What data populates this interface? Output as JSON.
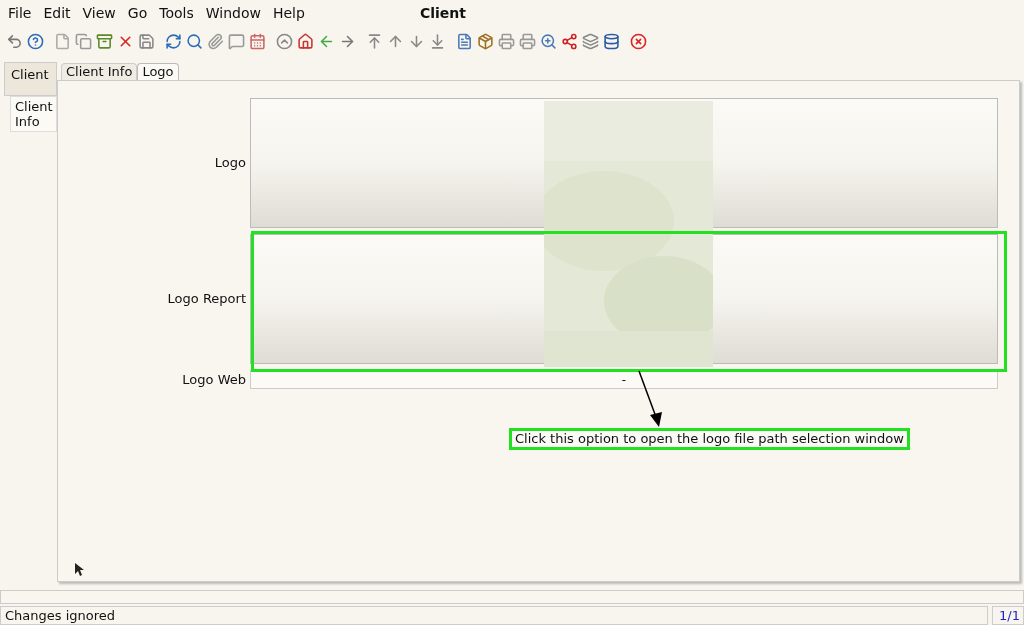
{
  "window": {
    "title": "Client"
  },
  "menu": [
    "File",
    "Edit",
    "View",
    "Go",
    "Tools",
    "Window",
    "Help"
  ],
  "side_tabs": [
    {
      "label": "Client",
      "selected": true
    },
    {
      "label": "Client Info",
      "selected": false
    }
  ],
  "tabs": [
    {
      "label": "Client Info",
      "selected": false
    },
    {
      "label": "Logo",
      "selected": true
    }
  ],
  "fields": [
    {
      "label": "Logo"
    },
    {
      "label": "Logo Report"
    },
    {
      "label": "Logo Web",
      "kind": "text",
      "value": "-"
    }
  ],
  "callout": {
    "text": "Click this option to open the logo file path selection window"
  },
  "status_bar": {
    "message": "Changes ignored",
    "record": "1/1"
  }
}
